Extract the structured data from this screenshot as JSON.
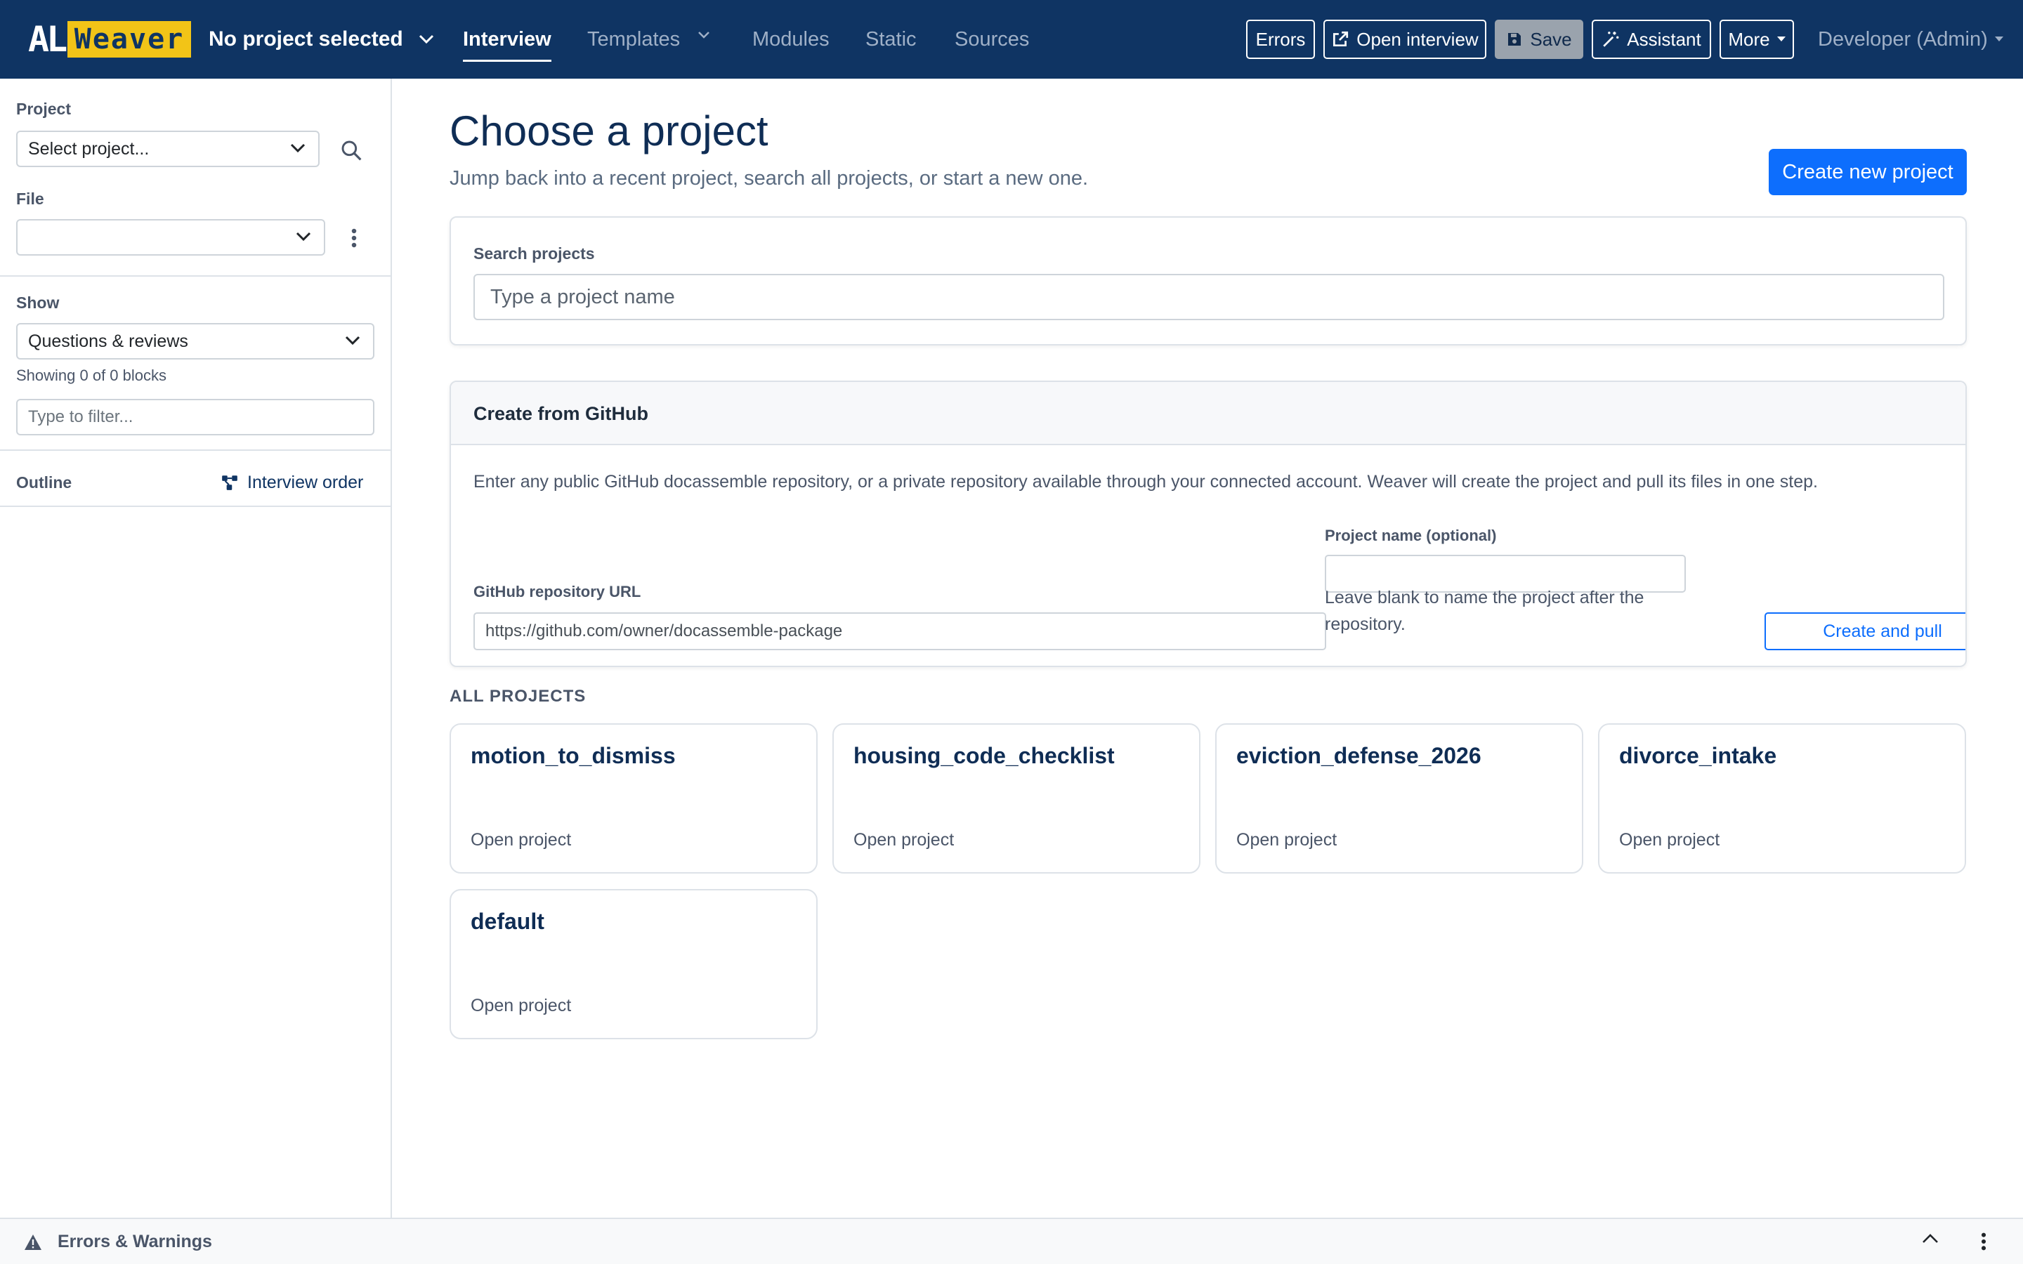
{
  "navbar": {
    "logo_al": "AL",
    "logo_weaver": "Weaver",
    "project_selector": "No project selected",
    "tabs": [
      {
        "label": "Interview",
        "active": true
      },
      {
        "label": "Templates",
        "active": false
      },
      {
        "label": "Modules",
        "active": false
      },
      {
        "label": "Static",
        "active": false
      },
      {
        "label": "Sources",
        "active": false
      }
    ],
    "buttons": {
      "errors": "Errors",
      "open_interview": "Open interview",
      "save": "Save",
      "assistant": "Assistant",
      "more": "More"
    },
    "user": "Developer (Admin)",
    "colors": {
      "background": "#0f3463",
      "logo_accent": "#f2c417"
    }
  },
  "sidebar": {
    "project_label": "Project",
    "project_select": "Select project...",
    "file_label": "File",
    "file_select": "",
    "show_label": "Show",
    "show_select": "Questions & reviews",
    "showing_count": "Showing 0 of 0 blocks",
    "filter_placeholder": "Type to filter...",
    "outline_label": "Outline",
    "interview_order_link": "Interview order"
  },
  "main": {
    "title": "Choose a project",
    "subtitle": "Jump back into a recent project, search all projects, or start a new one.",
    "create_button": "Create new project",
    "search": {
      "label": "Search projects",
      "placeholder": "Type a project name"
    },
    "github": {
      "header": "Create from GitHub",
      "description": "Enter any public GitHub docassemble repository, or a private repository available through your connected account. Weaver will create the project and pull its files in one step.",
      "url_label": "GitHub repository URL",
      "url_placeholder": "https://github.com/owner/docassemble-package",
      "name_label": "Project name (optional)",
      "name_value": "",
      "name_help": "Leave blank to name the project after the repository.",
      "submit": "Create and pull"
    },
    "all_projects_heading": "ALL PROJECTS",
    "projects": [
      {
        "name": "motion_to_dismiss",
        "action": "Open project"
      },
      {
        "name": "housing_code_checklist",
        "action": "Open project"
      },
      {
        "name": "eviction_defense_2026",
        "action": "Open project"
      },
      {
        "name": "divorce_intake",
        "action": "Open project"
      },
      {
        "name": "default",
        "action": "Open project"
      }
    ],
    "colors": {
      "primary": "#0d6efd",
      "heading": "#0f2d55"
    }
  },
  "bottom_bar": {
    "title": "Errors & Warnings"
  }
}
